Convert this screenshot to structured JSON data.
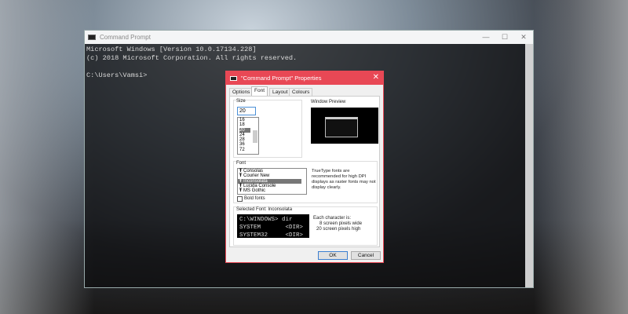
{
  "console": {
    "title": "Command Prompt",
    "controls": {
      "minimize": "—",
      "maximize": "☐",
      "close": "✕"
    },
    "lines": [
      "Microsoft Windows [Version 10.0.17134.228]",
      "(c) 2018 Microsoft Corporation. All rights reserved.",
      "",
      "C:\\Users\\Vamsi>"
    ]
  },
  "dialog": {
    "title": "\"Command Prompt\" Properties",
    "close": "✕",
    "tabs": [
      "Options",
      "Font",
      "Layout",
      "Colours"
    ],
    "size": {
      "label": "Size",
      "value": "20",
      "options": [
        "16",
        "18",
        "20",
        "24",
        "28",
        "36",
        "72"
      ],
      "selected": "20"
    },
    "window_preview": {
      "label": "Window Preview"
    },
    "font": {
      "label": "Font",
      "options": [
        "Consolas",
        "Courier New",
        "Inconsolata",
        "Lucida Console",
        "MS Gothic"
      ],
      "selected": "Inconsolata",
      "note": "TrueType fonts are recommended for high DPI displays as raster fonts may not display clearly.",
      "bold_label": "Bold fonts",
      "bold_checked": false
    },
    "selected_font": {
      "label": "Selected Font: Inconsolata",
      "preview_lines": [
        "C:\\WINDOWS> dir",
        "SYSTEM       <DIR>",
        "SYSTEM32     <DIR>"
      ],
      "info_title": "Each character is:",
      "info_width": "8 screen pixels wide",
      "info_height": "20 screen pixels high"
    },
    "ok": "OK",
    "cancel": "Cancel"
  }
}
